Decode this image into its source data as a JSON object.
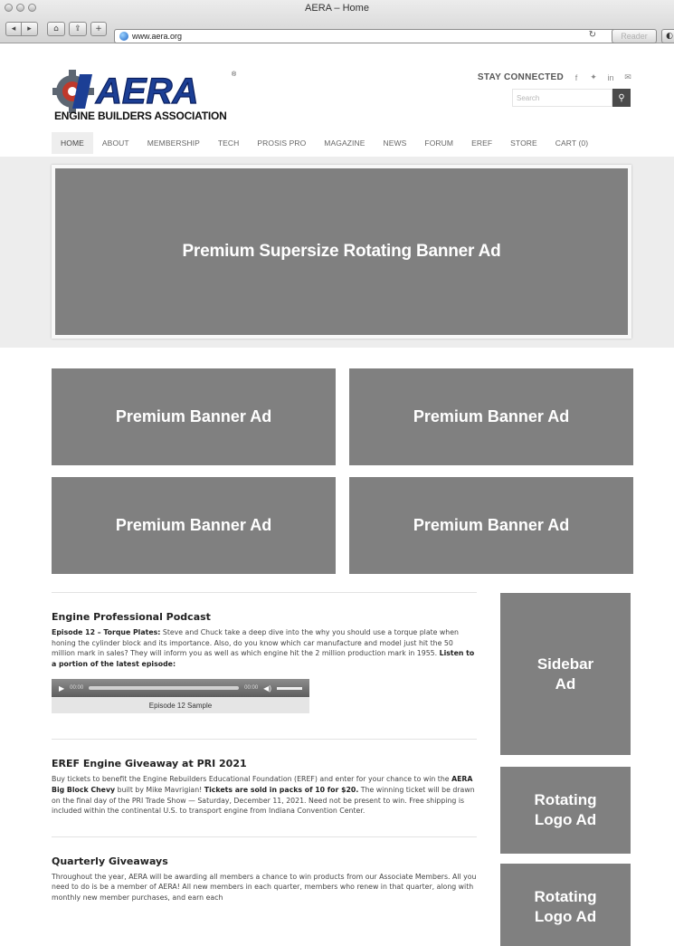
{
  "window": {
    "title": "AERA – Home",
    "url": "www.aera.org",
    "reader_label": "Reader"
  },
  "header": {
    "logo_text": "AERA",
    "logo_subtitle": "ENGINE BUILDERS ASSOCIATION",
    "stay_connected": "STAY CONNECTED",
    "social_icons": [
      "facebook-icon",
      "twitter-icon",
      "linkedin-icon",
      "email-icon"
    ],
    "search_placeholder": "Search"
  },
  "nav": {
    "items": [
      "HOME",
      "ABOUT",
      "MEMBERSHIP",
      "TECH",
      "PROSIS PRO",
      "MAGAZINE",
      "NEWS",
      "FORUM",
      "EREF",
      "STORE",
      "CART (0)"
    ],
    "active": "HOME"
  },
  "ads": {
    "hero": "Premium Supersize Rotating Banner Ad",
    "banners": [
      "Premium Banner Ad",
      "Premium Banner Ad",
      "Premium Banner Ad",
      "Premium Banner Ad"
    ],
    "sidebar": "Sidebar Ad",
    "logo_ads": [
      "Rotating Logo Ad",
      "Rotating Logo Ad"
    ]
  },
  "podcast": {
    "title": "Engine Professional Podcast",
    "lead": "Episode 12 – Torque Plates:",
    "body": " Steve and Chuck take a deep dive into the why you should use a torque plate when honing the cylinder block and its importance. Also, do you know which car manufacture and model just hit the 50 million mark in sales? They will inform you as well as which engine hit the 2 million production mark in 1955. ",
    "cta": "Listen to a portion of the latest episode:",
    "player_time_start": "00:00",
    "player_time_end": "00:00",
    "player_label": "Episode 12 Sample"
  },
  "giveaway": {
    "title": "EREF Engine Giveaway at PRI 2021",
    "part1": "Buy tickets to benefit the Engine Rebuilders Educational Foundation (EREF) and enter for your chance to win the ",
    "bold1": "AERA Big Block Chevy",
    "part2": " built by Mike Mavrigian! ",
    "bold2": "Tickets are sold in packs of 10 for $20.",
    "part3": " The winning ticket will be drawn on the final day of the PRI Trade Show — Saturday, December 11, 2021. Need not be present to win. Free shipping is included within the continental U.S. to transport engine from Indiana Convention Center."
  },
  "quarterly": {
    "title": "Quarterly Giveaways",
    "body": "Throughout the year, AERA will be awarding all members a chance to win products from our Associate Members. All you need to do is be a member of AERA! All new members in each quarter, members who renew in that quarter, along with monthly new member purchases, and earn each"
  }
}
